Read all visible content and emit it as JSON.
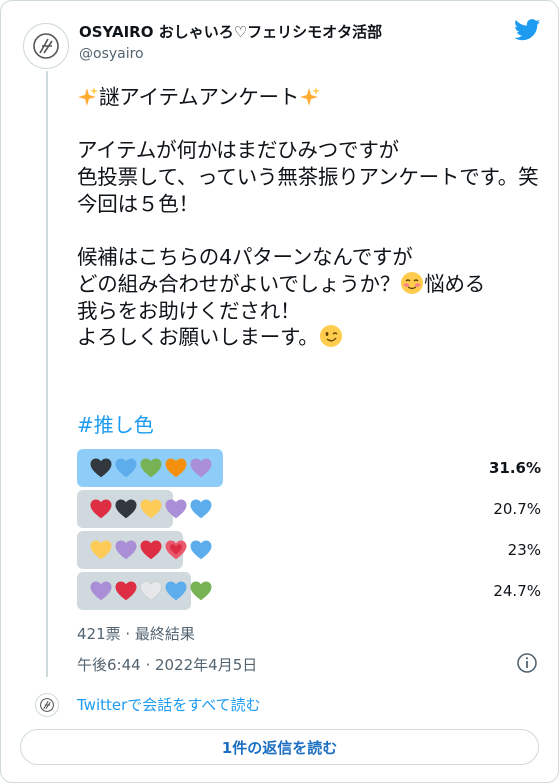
{
  "author": {
    "name": "OSYAIRO おしゃいろ♡フェリシモオタ活部",
    "handle": "@osyairo"
  },
  "tweet": {
    "title_line": "謎アイテムアンケート",
    "body": "アイテムが何かはまだひみつですが\n色投票して、っていう無茶振りアンケートです。笑\n今回は５色！\n\n候補はこちらの4パターンなんですが\nどの組み合わせがよいでしょうか？",
    "body_after_emoji": "悩める\n我らをお助けくだされ！\nよろしくお願いしまーす。",
    "hashtag": "#推し色"
  },
  "poll": {
    "options": [
      {
        "hearts": [
          "black",
          "blue",
          "green",
          "orange",
          "purple"
        ],
        "percent": 31.6,
        "label": "31.6%",
        "leading": true
      },
      {
        "hearts": [
          "red",
          "black",
          "yellow",
          "purple",
          "blue"
        ],
        "percent": 20.7,
        "label": "20.7%",
        "leading": false
      },
      {
        "hearts": [
          "yellow",
          "purple",
          "red",
          "sparkling",
          "blue"
        ],
        "percent": 23,
        "label": "23%",
        "leading": false
      },
      {
        "hearts": [
          "purple",
          "red",
          "white",
          "blue",
          "green"
        ],
        "percent": 24.7,
        "label": "24.7%",
        "leading": false
      }
    ],
    "meta": "421票 · 最終結果"
  },
  "timestamp": "午後6:44 · 2022年4月5日",
  "read_conversation": "Twitterで会話をすべて読む",
  "reply_button": "1件の返信を読む",
  "colors": {
    "brand": "#1d9bf0",
    "leading_bar": "#8ecdf8",
    "bar": "#cfd9de",
    "black": "#31373d",
    "blue": "#5dadec",
    "green": "#77b255",
    "orange": "#f4900c",
    "purple": "#aa8ed6",
    "red": "#dd2e44",
    "yellow": "#fdcb58",
    "white": "#e6e7e8",
    "sparkling": "#ea596e"
  }
}
